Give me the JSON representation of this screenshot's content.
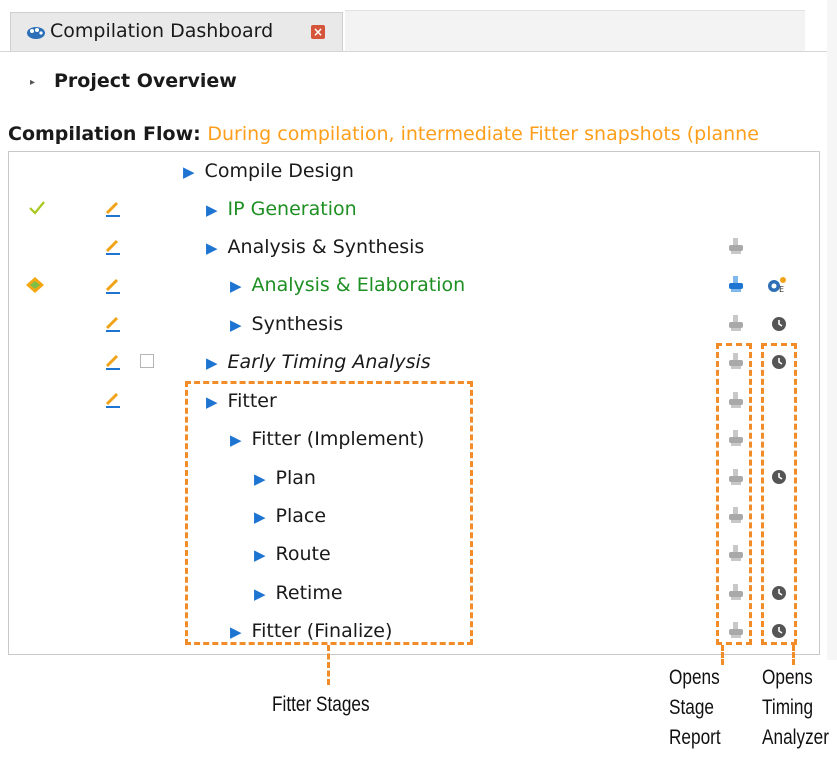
{
  "tab": {
    "title": "Compilation Dashboard",
    "close_glyph": "×"
  },
  "project_overview": {
    "label": "Project Overview"
  },
  "compilation_flow": {
    "label": "Compilation Flow",
    "separator": ": ",
    "message": "During compilation, intermediate Fitter snapshots (planne"
  },
  "tree": {
    "rows": [
      {
        "label": "Compile Design"
      },
      {
        "label": "IP Generation"
      },
      {
        "label": "Analysis & Synthesis"
      },
      {
        "label": "Analysis & Elaboration"
      },
      {
        "label": "Synthesis"
      },
      {
        "label": "Early Timing Analysis"
      },
      {
        "label": "Fitter"
      },
      {
        "label": "Fitter (Implement)"
      },
      {
        "label": "Plan"
      },
      {
        "label": "Place"
      },
      {
        "label": "Route"
      },
      {
        "label": "Retime"
      },
      {
        "label": "Fitter (Finalize)"
      }
    ]
  },
  "annotations": {
    "fitter_stages": "Fitter Stages",
    "opens_stage_report": [
      "Opens",
      "Stage",
      "Report"
    ],
    "opens_timing_analyzer": [
      "Opens",
      "Timing",
      "Analyzer"
    ]
  },
  "colors": {
    "accent_blue": "#1e74d1",
    "success_green": "#1e8f22",
    "warning_orange": "#ff9e1b",
    "annotation_orange": "#f28c28"
  }
}
